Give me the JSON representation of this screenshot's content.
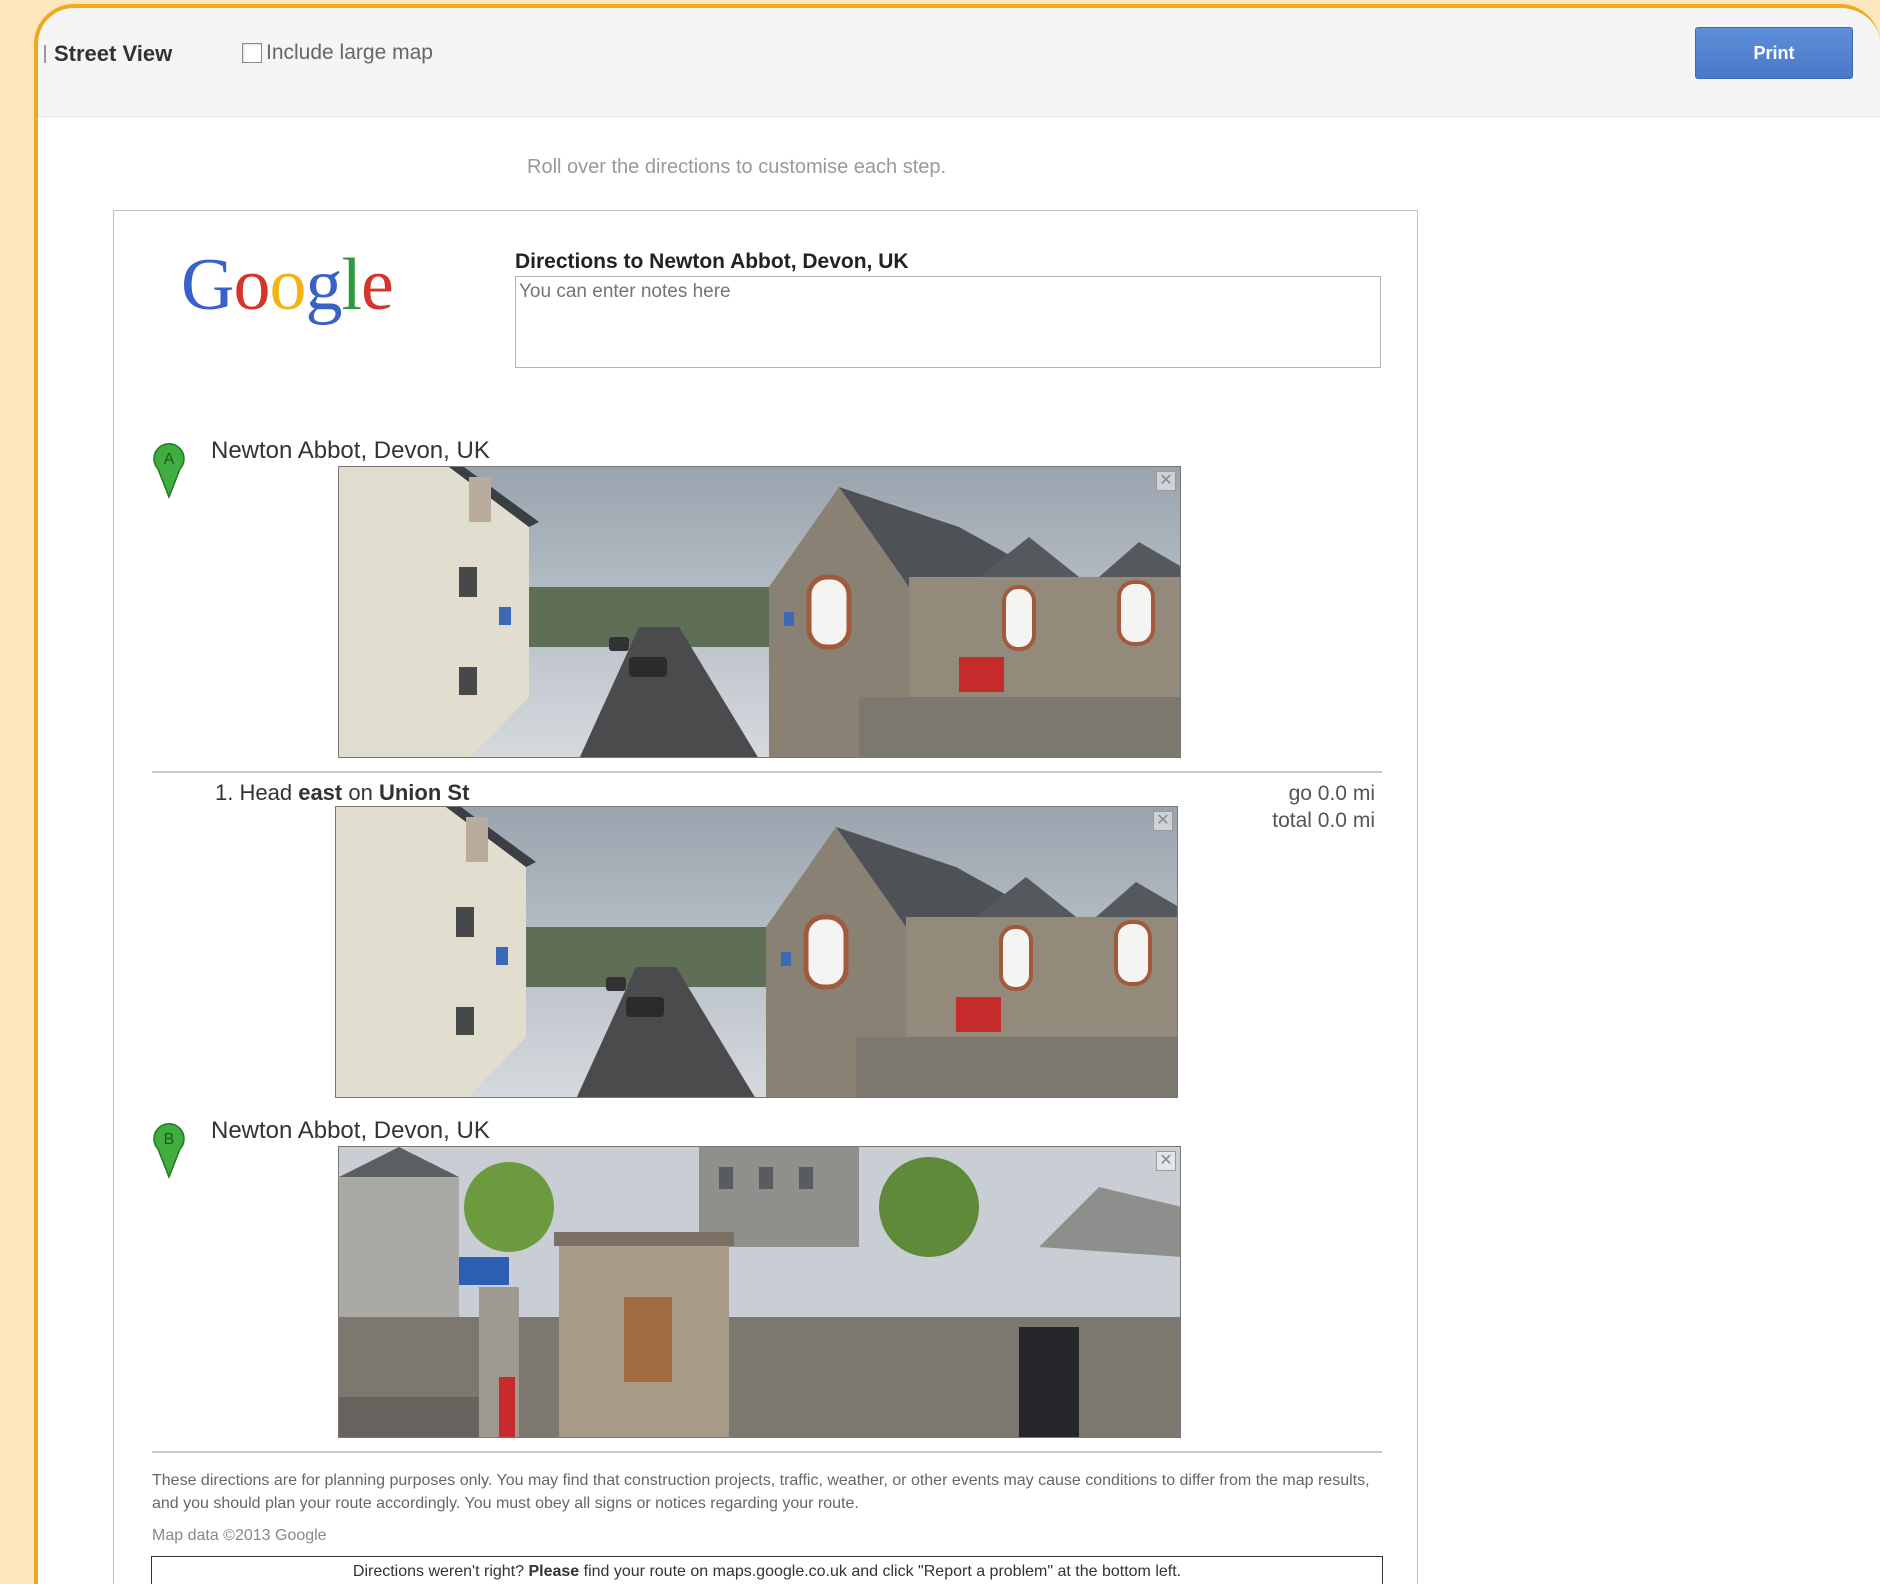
{
  "toolbar": {
    "street_view_label": "Street View",
    "include_large_map_label": "Include large map",
    "include_large_map_checked": false,
    "print_label": "Print"
  },
  "hint": "Roll over the directions to customise each step.",
  "logo": {
    "letters": [
      "G",
      "o",
      "o",
      "g",
      "l",
      "e"
    ],
    "colors": [
      "#3a61c8",
      "#d4352b",
      "#f2b414",
      "#3a61c8",
      "#2e9b3e",
      "#d4352b"
    ]
  },
  "directions": {
    "title": "Directions to Newton Abbot, Devon, UK",
    "notes_placeholder": "You can enter notes here"
  },
  "start": {
    "marker": "A",
    "marker_color": "#3fae3f",
    "address": "Newton Abbot, Devon, UK",
    "close_symbol": "✕"
  },
  "step1": {
    "number": "1.",
    "verb": "Head",
    "direction": "east",
    "connector": "on",
    "street": "Union St",
    "go_prefix": "go",
    "go_value": "0.0",
    "go_unit": "mi",
    "total_prefix": "total",
    "total_value": "0.0",
    "total_unit": "mi",
    "close_symbol": "✕"
  },
  "end": {
    "marker": "B",
    "marker_color": "#3fae3f",
    "address": "Newton Abbot, Devon, UK",
    "close_symbol": "✕"
  },
  "disclaimer": "These directions are for planning purposes only. You may find that construction projects, traffic, weather, or other events may cause conditions to differ from the map results, and you should plan your route accordingly. You must obey all signs or notices regarding your route.",
  "map_data": "Map data ©2013 Google",
  "report": {
    "prefix": "Directions weren't right?",
    "bold": "Please",
    "suffix": "find your route on maps.google.co.uk and click \"Report a problem\" at the bottom left."
  }
}
